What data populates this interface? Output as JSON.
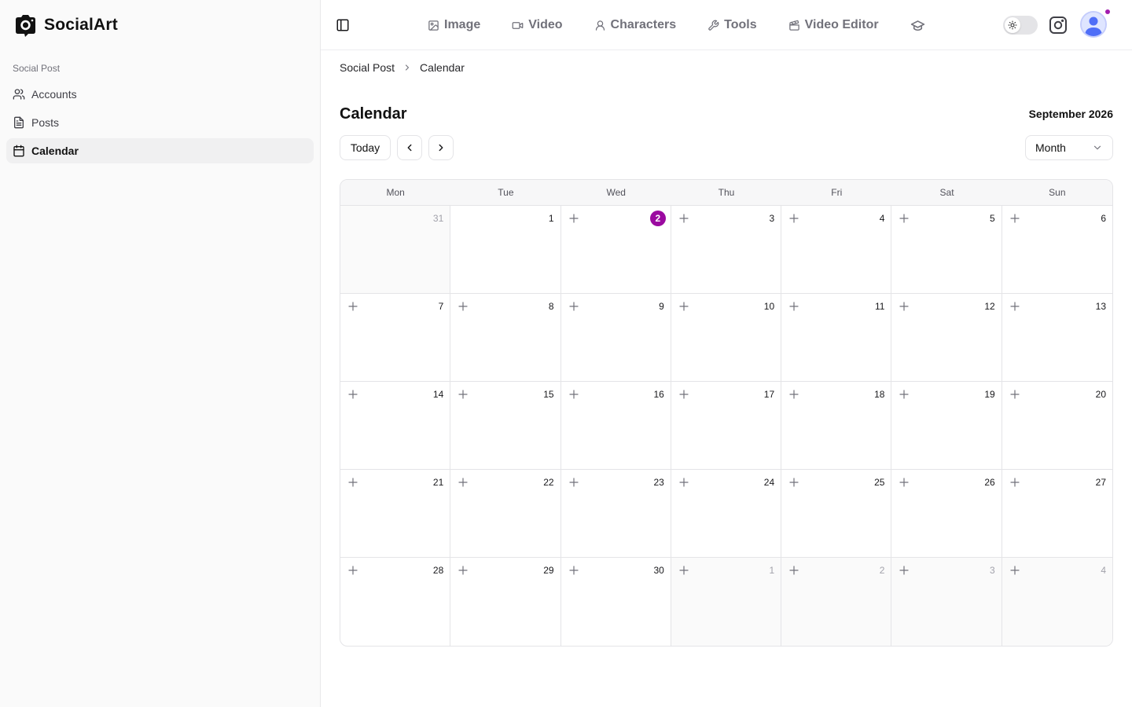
{
  "app": {
    "name": "SocialArt"
  },
  "sidebar": {
    "group_label": "Social Post",
    "items": [
      {
        "label": "Accounts",
        "icon": "users-icon",
        "active": false
      },
      {
        "label": "Posts",
        "icon": "file-text-icon",
        "active": false
      },
      {
        "label": "Calendar",
        "icon": "calendar-icon",
        "active": true
      }
    ]
  },
  "header": {
    "nav": [
      {
        "label": "Image",
        "icon": "image-icon"
      },
      {
        "label": "Video",
        "icon": "video-icon"
      },
      {
        "label": "Characters",
        "icon": "user-icon"
      },
      {
        "label": "Tools",
        "icon": "wrench-icon"
      },
      {
        "label": "Video Editor",
        "icon": "clapperboard-icon"
      }
    ],
    "extra_icon": "graduation-cap-icon"
  },
  "breadcrumb": {
    "parent": "Social Post",
    "current": "Calendar"
  },
  "page": {
    "title": "Calendar",
    "month_label": "September 2026"
  },
  "controls": {
    "today_label": "Today",
    "view_value": "Month"
  },
  "calendar": {
    "weekdays": [
      "Mon",
      "Tue",
      "Wed",
      "Thu",
      "Fri",
      "Sat",
      "Sun"
    ],
    "weeks": [
      [
        {
          "day": "31",
          "outside": true
        },
        {
          "day": "1",
          "outside": false
        },
        {
          "day": "2",
          "outside": false,
          "today": true
        },
        {
          "day": "3",
          "outside": false
        },
        {
          "day": "4",
          "outside": false
        },
        {
          "day": "5",
          "outside": false
        },
        {
          "day": "6",
          "outside": false
        }
      ],
      [
        {
          "day": "7",
          "outside": false
        },
        {
          "day": "8",
          "outside": false
        },
        {
          "day": "9",
          "outside": false
        },
        {
          "day": "10",
          "outside": false
        },
        {
          "day": "11",
          "outside": false
        },
        {
          "day": "12",
          "outside": false
        },
        {
          "day": "13",
          "outside": false
        }
      ],
      [
        {
          "day": "14",
          "outside": false
        },
        {
          "day": "15",
          "outside": false
        },
        {
          "day": "16",
          "outside": false
        },
        {
          "day": "17",
          "outside": false
        },
        {
          "day": "18",
          "outside": false
        },
        {
          "day": "19",
          "outside": false
        },
        {
          "day": "20",
          "outside": false
        }
      ],
      [
        {
          "day": "21",
          "outside": false
        },
        {
          "day": "22",
          "outside": false
        },
        {
          "day": "23",
          "outside": false
        },
        {
          "day": "24",
          "outside": false
        },
        {
          "day": "25",
          "outside": false
        },
        {
          "day": "26",
          "outside": false
        },
        {
          "day": "27",
          "outside": false
        }
      ],
      [
        {
          "day": "28",
          "outside": false
        },
        {
          "day": "29",
          "outside": false
        },
        {
          "day": "30",
          "outside": false
        },
        {
          "day": "1",
          "outside": true
        },
        {
          "day": "2",
          "outside": true
        },
        {
          "day": "3",
          "outside": true
        },
        {
          "day": "4",
          "outside": true
        }
      ]
    ]
  },
  "colors": {
    "today_accent": "#9b0aa0",
    "border": "#e4e4e7",
    "muted_text": "#71717a"
  }
}
